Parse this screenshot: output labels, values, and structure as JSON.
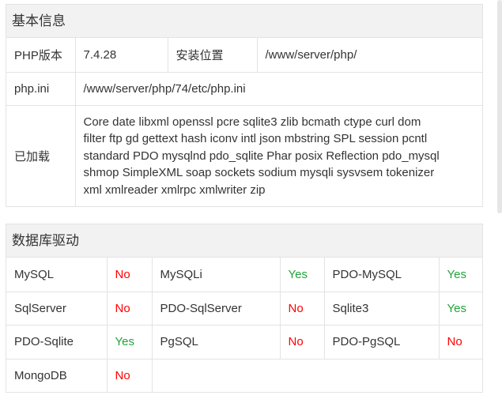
{
  "basic": {
    "title": "基本信息",
    "php_version_label": "PHP版本",
    "php_version_value": "7.4.28",
    "install_path_label": "安装位置",
    "install_path_value": "/www/server/php/",
    "ini_label": "php.ini",
    "ini_value": "/www/server/php/74/etc/php.ini",
    "loaded_label": "已加载",
    "loaded_lines": [
      "Core date libxml openssl pcre sqlite3 zlib bcmath ctype curl dom",
      "filter ftp gd gettext hash iconv intl json mbstring SPL session pcntl",
      "standard PDO mysqlnd pdo_sqlite Phar posix Reflection pdo_mysql",
      "shmop SimpleXML soap sockets sodium mysqli sysvsem tokenizer",
      "xml xmlreader xmlrpc xmlwriter zip"
    ]
  },
  "drivers": {
    "title": "数据库驱动",
    "rows": [
      [
        [
          "MySQL",
          "No"
        ],
        [
          "MySQLi",
          "Yes"
        ],
        [
          "PDO-MySQL",
          "Yes"
        ]
      ],
      [
        [
          "SqlServer",
          "No"
        ],
        [
          "PDO-SqlServer",
          "No"
        ],
        [
          "Sqlite3",
          "Yes"
        ]
      ],
      [
        [
          "PDO-Sqlite",
          "Yes"
        ],
        [
          "PgSQL",
          "No"
        ],
        [
          "PDO-PgSQL",
          "No"
        ]
      ],
      [
        [
          "MongoDB",
          "No"
        ]
      ]
    ]
  }
}
